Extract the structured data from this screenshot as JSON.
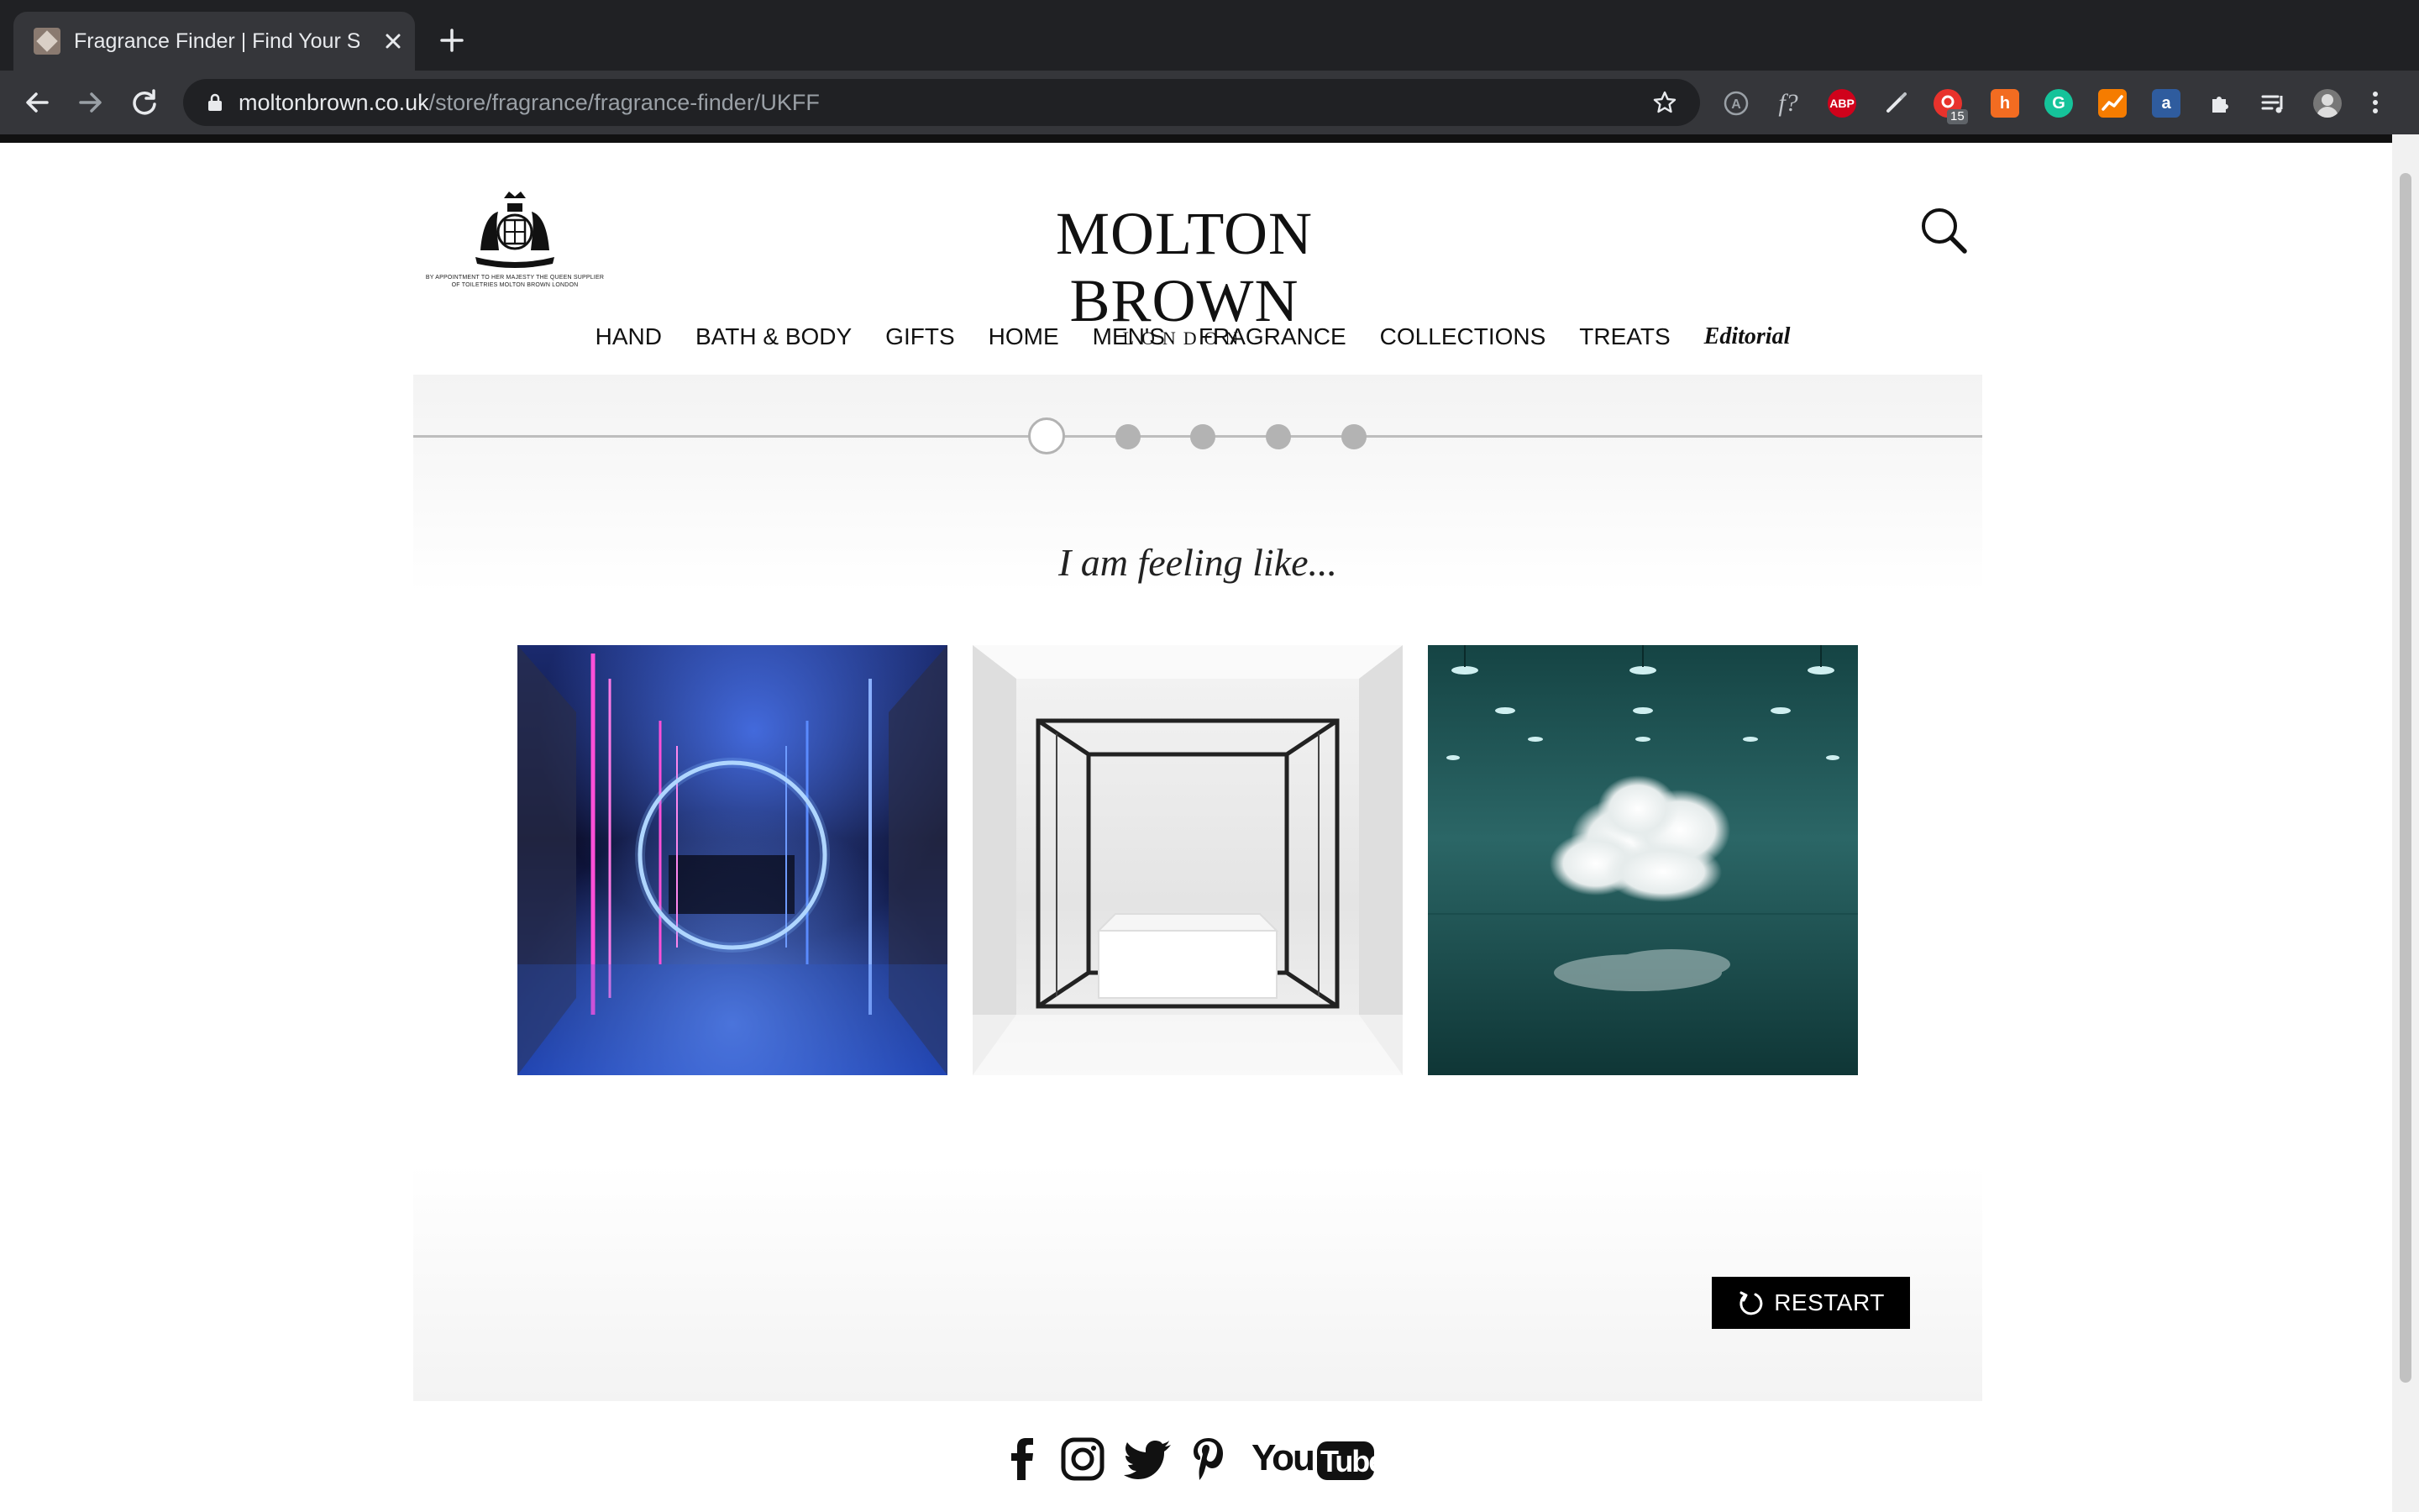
{
  "browser": {
    "tab_title": "Fragrance Finder | Find Your Si",
    "url_host": "moltonbrown.co.uk",
    "url_path": "/store/fragrance/fragrance-finder/UKFF",
    "extensions": [
      {
        "name": "translate-extension",
        "label": "A",
        "color": "#35363a"
      },
      {
        "name": "whatfont-extension",
        "label": "f?",
        "color": "#35363a"
      },
      {
        "name": "adblock-plus-extension",
        "label": "ABP",
        "color": "#d0021b"
      },
      {
        "name": "pen-extension",
        "label": "",
        "color": "#35363a"
      },
      {
        "name": "red-extension",
        "label": "",
        "color": "#e8322c",
        "badge": "15"
      },
      {
        "name": "honey-extension",
        "label": "h",
        "color": "#f26c21"
      },
      {
        "name": "grammarly-extension",
        "label": "G",
        "color": "#15c39a"
      },
      {
        "name": "analytics-extension",
        "label": "",
        "color": "#f57c00"
      },
      {
        "name": "amazon-assistant-extension",
        "label": "a",
        "color": "#2f5c9e"
      }
    ]
  },
  "site": {
    "crest_text": "BY APPOINTMENT TO HER MAJESTY THE QUEEN SUPPLIER OF TOILETRIES MOLTON BROWN LONDON",
    "logo_main": "MOLTON BROWN",
    "logo_sub": "LONDON"
  },
  "nav": {
    "items": [
      "HAND",
      "BATH & BODY",
      "GIFTS",
      "HOME",
      "MEN'S",
      "FRAGRANCE",
      "COLLECTIONS",
      "TREATS",
      "Editorial"
    ]
  },
  "finder": {
    "current_step": 1,
    "total_steps": 5,
    "question": "I am feeling like...",
    "restart_label": "RESTART"
  },
  "colors": {
    "chrome_dark": "#202124",
    "chrome_toolbar": "#35363a",
    "step_grey": "#b3b3b3",
    "button_black": "#000000"
  }
}
